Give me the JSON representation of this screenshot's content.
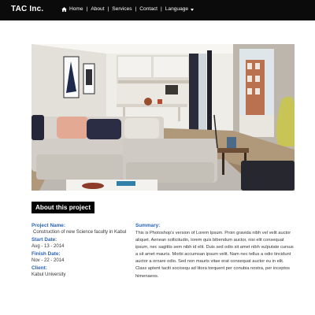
{
  "header": {
    "brand": "TAC  Inc.",
    "nav": [
      {
        "label": "Home"
      },
      {
        "label": "About"
      },
      {
        "label": "Services"
      },
      {
        "label": "Contact"
      },
      {
        "label": "Language"
      }
    ],
    "separator": "|"
  },
  "hero": {
    "icon": "living-room-photo",
    "colors": {
      "sofa": "#d7d3cc",
      "wall": "#f3f1ec",
      "floor": "#a88f72"
    }
  },
  "project": {
    "heading": "About this project",
    "project_name_label": "Project Name:",
    "project_name": "Construction of new Science faculty in Kabul",
    "start_date_label": "Start Date:",
    "start_date": "Aug - 13 - 2014",
    "finish_date_label": "Finish Date:",
    "finish_date": "Nov - 22 - 2014",
    "client_label": "Client:",
    "client": "Kabul University",
    "summary_label": "Summary:",
    "summary": "This is Photoshop's version  of Lorem Ipsum. Proin gravida nibh vel velit auctor aliquet. Aenean sollicitudin, lorem quis bibendum auctor, nisi elit consequat ipsum, nec sagittis sem nibh id elit. Duis sed odio sit amet nibh vulputate cursus a sit amet mauris. Morbi accumsan ipsum velit. Nam nec tellus a odio tincidunt auctor a ornare odio. Sed non  mauris vitae erat consequat auctor eu in elit. Class aptent taciti sociosqu ad litora torquent per conubia nostra, per inceptos himenaeos."
  },
  "colors": {
    "navbar": "#0b0b0b",
    "label_blue": "#2a63b7",
    "heading_bg": "#000000"
  }
}
